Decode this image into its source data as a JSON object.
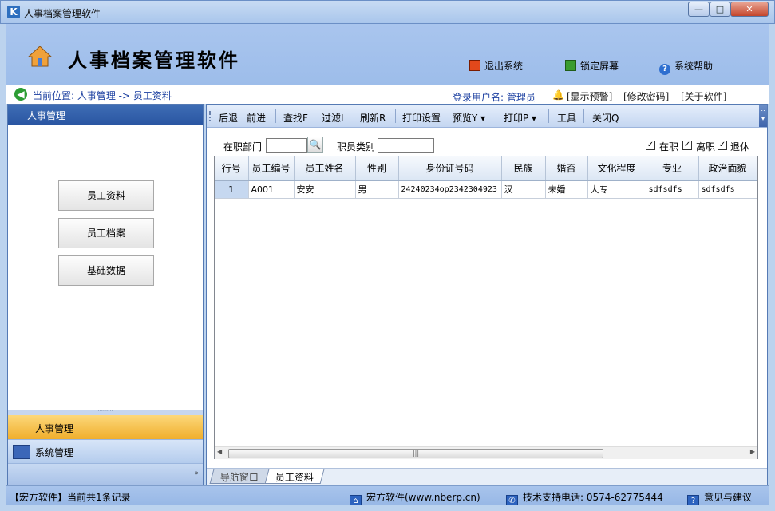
{
  "window": {
    "title": "人事档案管理软件",
    "min": "—",
    "max": "□",
    "close": "✕"
  },
  "header": {
    "app_name": "人事档案管理软件",
    "actions": {
      "exit": "退出系统",
      "lock": "锁定屏幕",
      "help": "系统帮助"
    }
  },
  "location": {
    "path": "当前位置: 人事管理 -> 员工资料",
    "user": "登录用户名: 管理员",
    "warn": "[显示预警]",
    "pwd": "[修改密码]",
    "about": "[关于软件]"
  },
  "sidebar": {
    "header": "人事管理",
    "buttons": [
      "员工资料",
      "员工档案",
      "基础数据"
    ],
    "group_hr": "人事管理",
    "group_sys": "系统管理"
  },
  "toolbar": {
    "back": "后退",
    "forward": "前进",
    "find": "查找F",
    "filter": "过滤L",
    "refresh": "刷新R",
    "print_setup": "打印设置",
    "preview": "预览Y ▾",
    "print": "打印P ▾",
    "tools": "工具",
    "close": "关闭Q"
  },
  "filter": {
    "dept_label": "在职部门",
    "dept_value": "",
    "category_label": "职员类别",
    "category_value": "",
    "chk_active": {
      "label": "在职",
      "checked": true
    },
    "chk_left": {
      "label": "离职",
      "checked": true
    },
    "chk_retired": {
      "label": "退休",
      "checked": true
    }
  },
  "grid": {
    "columns": [
      "行号",
      "员工编号",
      "员工姓名",
      "性别",
      "身份证号码",
      "民族",
      "婚否",
      "文化程度",
      "专业",
      "政治面貌"
    ],
    "rows": [
      [
        "1",
        "A001",
        "安安",
        "男",
        "24240234op2342304923",
        "汉",
        "未婚",
        "大专",
        "sdfsdfs",
        "sdfsdfs"
      ]
    ]
  },
  "tabs": {
    "nav": "导航窗口",
    "employee": "员工资料"
  },
  "status": {
    "left": "【宏方软件】当前共1条记录",
    "site": "宏方软件(www.nberp.cn)",
    "phone": "技术支持电话: 0574-62775444",
    "feedback": "意见与建议"
  }
}
